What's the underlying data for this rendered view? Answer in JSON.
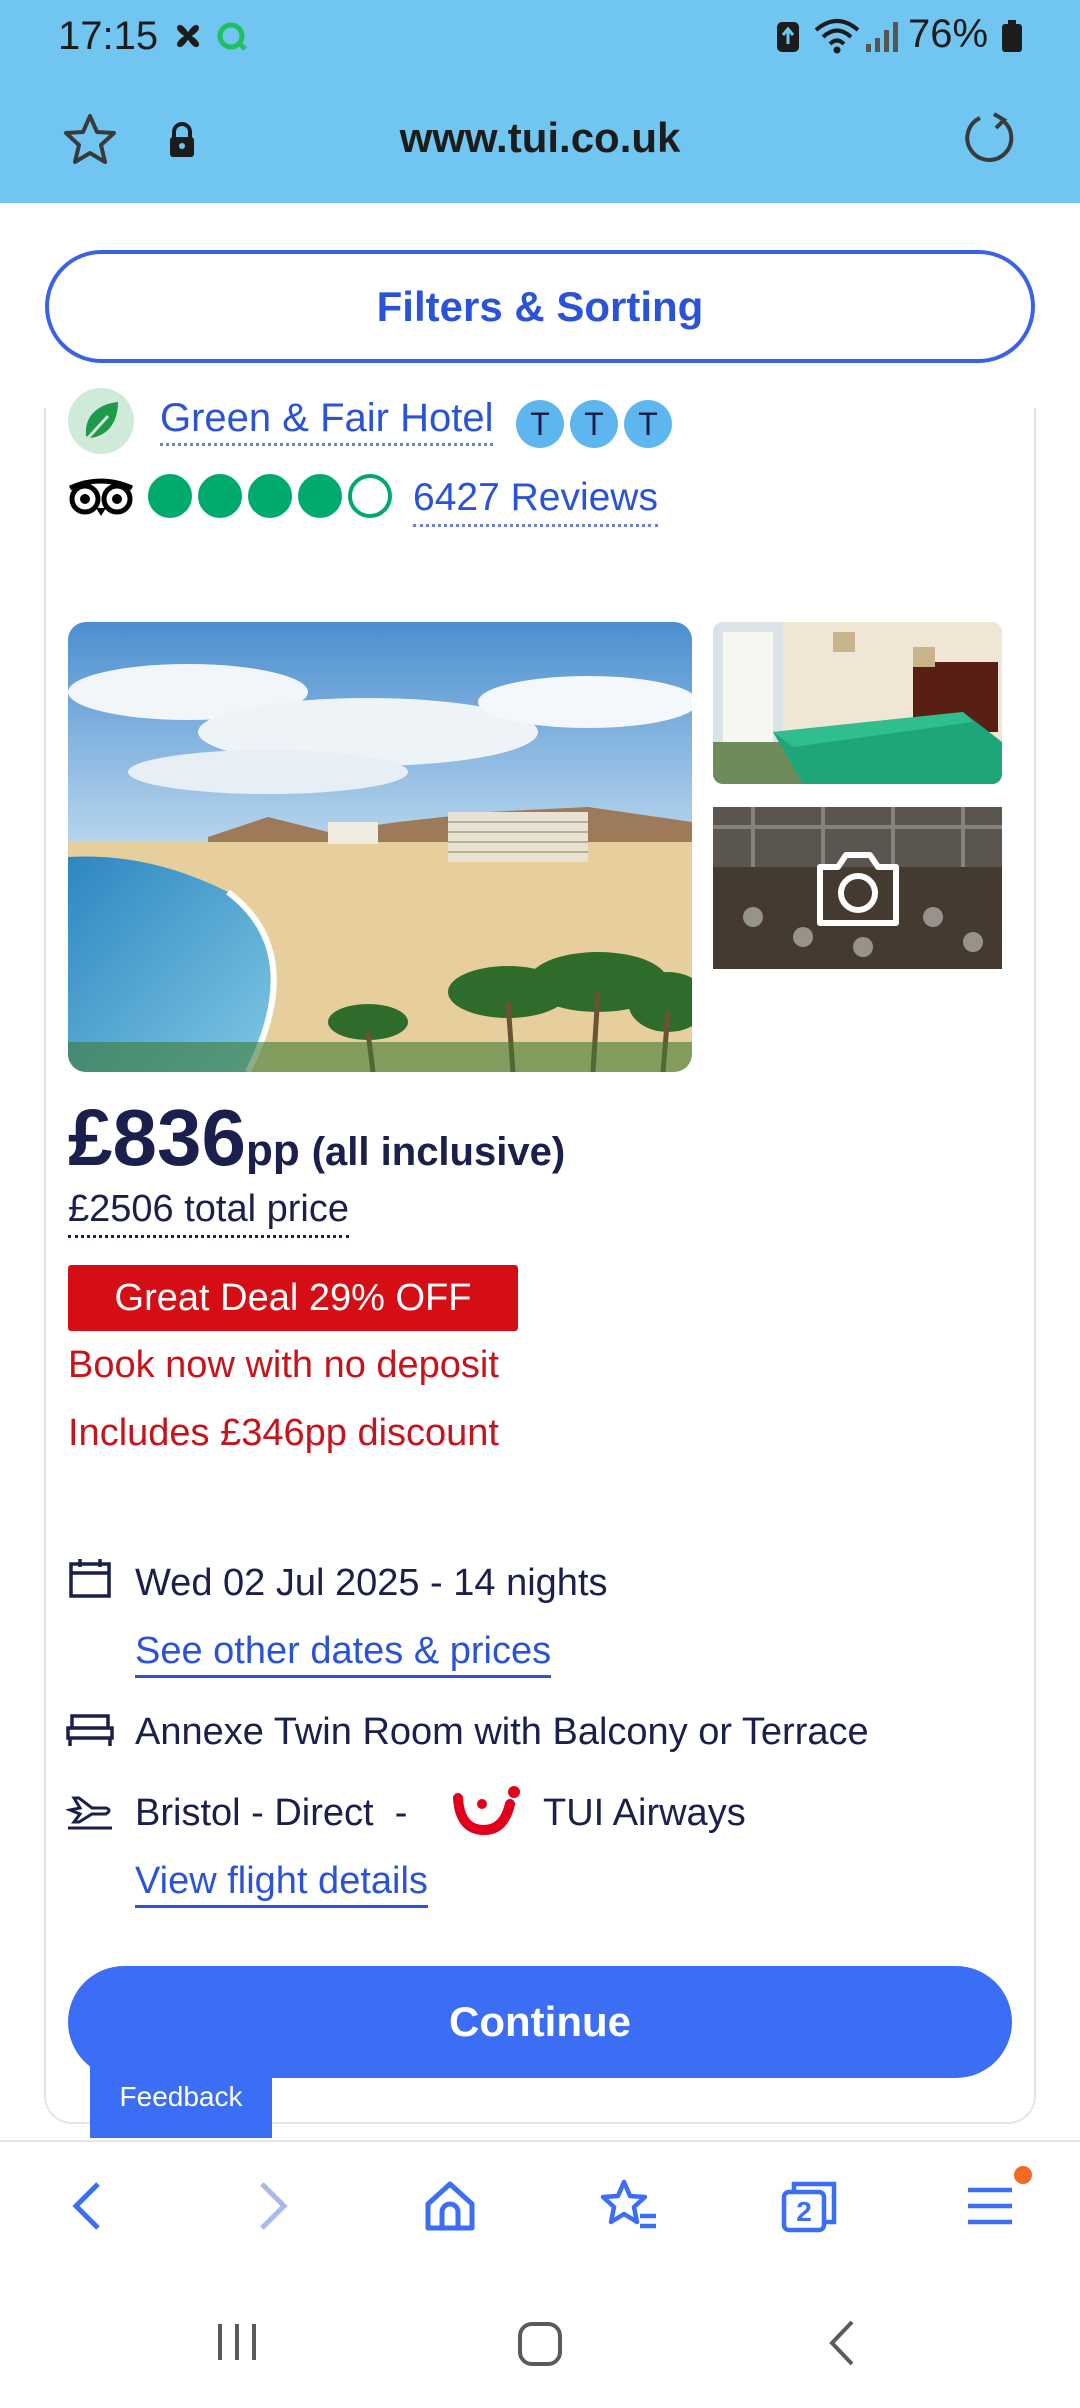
{
  "status_bar": {
    "time": "17:15",
    "battery": "76%"
  },
  "browser": {
    "url": "www.tui.co.uk",
    "tab_count": "2"
  },
  "filters": {
    "label": "Filters & Sorting"
  },
  "hotel": {
    "green_label": "Green & Fair Hotel",
    "t_badges": [
      "T",
      "T",
      "T"
    ],
    "tripadvisor_rating": 4,
    "tripadvisor_max": 5,
    "reviews_label": "6427 Reviews"
  },
  "pricing": {
    "price": "£836",
    "per_person": "pp",
    "board": "(all inclusive)",
    "total_price": "£2506 total price",
    "deal_badge": "Great Deal 29% OFF",
    "no_deposit": "Book now with no deposit",
    "discount": "Includes £346pp discount"
  },
  "details": {
    "date_text": "Wed 02 Jul 2025 - 14 nights",
    "other_dates_link": "See other dates & prices",
    "room_text": "Annexe Twin Room with Balcony or Terrace",
    "flight_text": "Bristol - Direct  -",
    "airline": "TUI Airways",
    "flight_link": "View flight details"
  },
  "actions": {
    "continue_label": "Continue",
    "feedback_label": "Feedback"
  },
  "colors": {
    "toolbar_bg": "#70c6f0",
    "accent_blue": "#3b6ef5",
    "deal_red": "#d40e14",
    "tripadvisor_green": "#00aa6c"
  }
}
